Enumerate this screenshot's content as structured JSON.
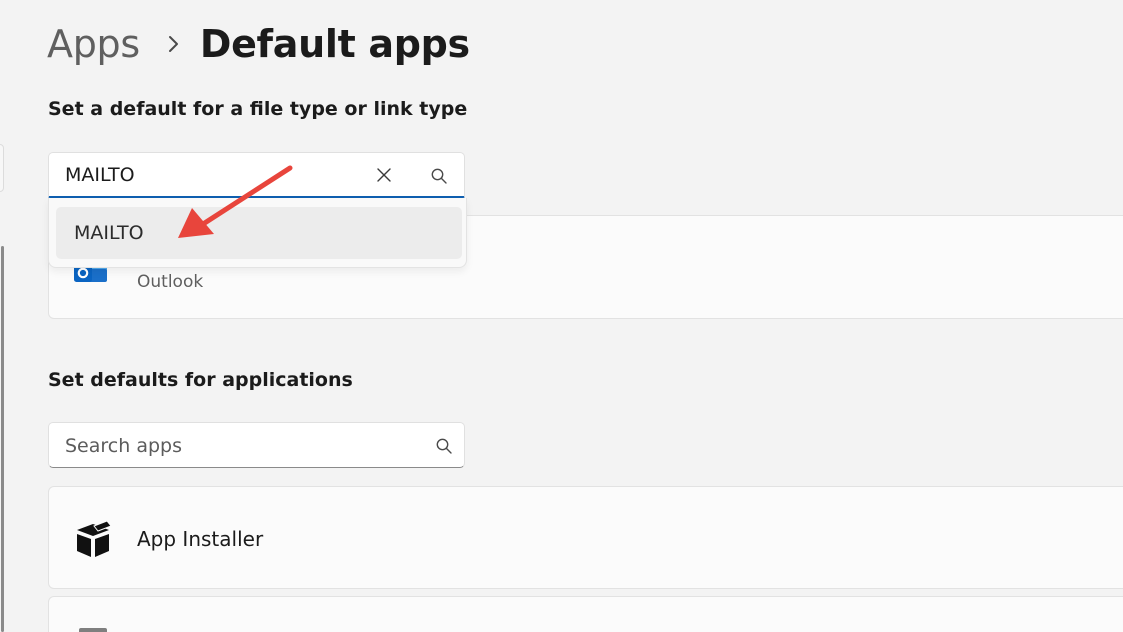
{
  "breadcrumb": {
    "parent": "Apps",
    "current": "Default apps"
  },
  "file_type_section": {
    "heading": "Set a default for a file type or link type",
    "search_value": "MAILTO",
    "suggestion": "MAILTO",
    "result": {
      "app_name": "Outlook",
      "icon": "outlook-icon"
    }
  },
  "apps_section": {
    "heading": "Set defaults for applications",
    "search_placeholder": "Search apps",
    "apps": [
      {
        "name": "App Installer",
        "icon": "package-icon"
      }
    ]
  },
  "colors": {
    "accent": "#0f5fb0",
    "annotation_arrow": "#e8453c"
  }
}
